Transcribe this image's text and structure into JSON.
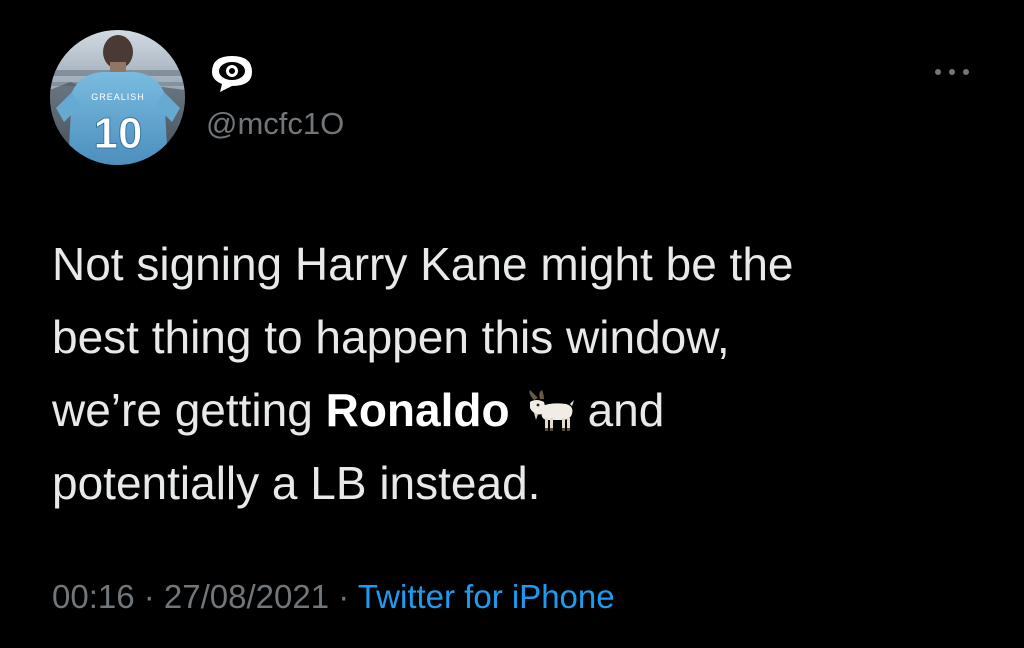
{
  "user": {
    "avatar_icon": "football-player-jersey-10-avatar",
    "name_icon": "eye-speech-bubble-icon",
    "handle": "@mcfc1O"
  },
  "more_icon": "more-options-ellipsis-icon",
  "tweet": {
    "line1": "Not signing Harry Kane might be the",
    "line2": "best thing to happen this window,",
    "line3_prefix": "we’re getting ",
    "line3_bold": "Ronaldo",
    "emoji_icon": "goat-emoji-icon",
    "line3_suffix": "and",
    "line4": "potentially a LB instead."
  },
  "meta": {
    "time": "00:16",
    "separator1": " · ",
    "date": "27/08/2021",
    "separator2": " · ",
    "source": "Twitter for iPhone"
  },
  "colors": {
    "background": "#000000",
    "text": "#e7e9ea",
    "muted": "#71767b",
    "link": "#1d9bf0"
  }
}
